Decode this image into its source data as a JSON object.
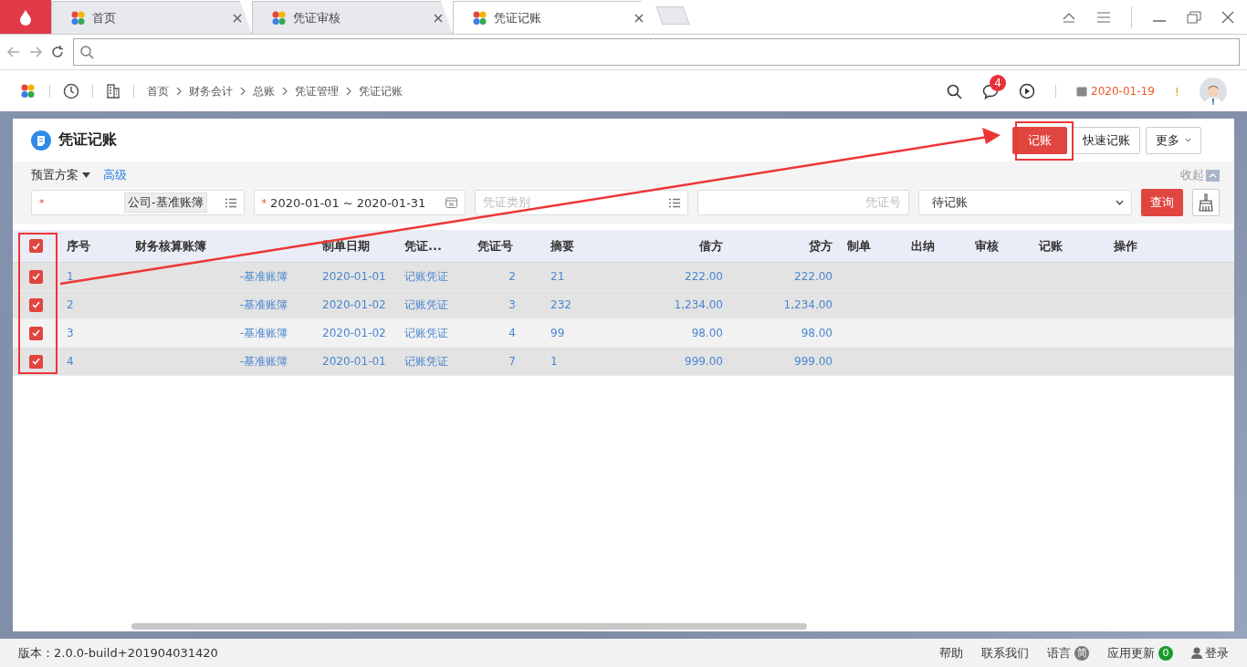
{
  "browser": {
    "tabs": [
      {
        "label": "首页",
        "selected": false
      },
      {
        "label": "凭证审核",
        "selected": false
      },
      {
        "label": "凭证记账",
        "selected": true
      }
    ]
  },
  "app_header": {
    "breadcrumb": [
      "首页",
      "财务会计",
      "总账",
      "凭证管理",
      "凭证记账"
    ],
    "notification_count": "4",
    "date": "2020-01-19",
    "alert": "!"
  },
  "page": {
    "title": "凭证记账",
    "buttons": [
      {
        "label": "记账",
        "kind": "primary"
      },
      {
        "label": "快速记账",
        "kind": "default"
      },
      {
        "label": "更多",
        "kind": "dropdown"
      }
    ]
  },
  "filters": {
    "preset": "预置方案",
    "advanced": "高级",
    "collapse": "收起",
    "ledger": {
      "value": "公司-基准账簿",
      "required_mark": "*"
    },
    "date_range": {
      "value": "2020-01-01 ~ 2020-01-31",
      "required_mark": "*"
    },
    "voucher_type": {
      "placeholder": "凭证类别"
    },
    "voucher_no": {
      "placeholder": "凭证号"
    },
    "status": {
      "value": "待记账"
    },
    "query": "查询"
  },
  "table": {
    "all_checked": true,
    "columns": [
      {
        "label": "序号",
        "kind": "text"
      },
      {
        "label": "财务核算账簿",
        "kind": "text"
      },
      {
        "label": "制单日期",
        "kind": "text"
      },
      {
        "label": "凭证...",
        "kind": "text"
      },
      {
        "label": "凭证号",
        "kind": "text"
      },
      {
        "label": "摘要",
        "kind": "text"
      },
      {
        "label": "借方",
        "kind": "amount"
      },
      {
        "label": "贷方",
        "kind": "amount"
      },
      {
        "label": "制单",
        "kind": "text"
      },
      {
        "label": "出纳",
        "kind": "text"
      },
      {
        "label": "审核",
        "kind": "text"
      },
      {
        "label": "记账",
        "kind": "text"
      },
      {
        "label": "操作",
        "kind": "action"
      }
    ],
    "rows": [
      {
        "checked": true,
        "hovered": false,
        "cells": [
          "1",
          "-基准账簿",
          "2020-01-01",
          "记账凭证",
          "2",
          "21",
          "222.00",
          "222.00"
        ]
      },
      {
        "checked": true,
        "hovered": false,
        "cells": [
          "2",
          "-基准账簿",
          "2020-01-02",
          "记账凭证",
          "3",
          "232",
          "1,234.00",
          "1,234.00"
        ]
      },
      {
        "checked": true,
        "hovered": true,
        "cells": [
          "3",
          "-基准账簿",
          "2020-01-02",
          "记账凭证",
          "4",
          "99",
          "98.00",
          "98.00"
        ]
      },
      {
        "checked": true,
        "hovered": false,
        "cells": [
          "4",
          "-基准账簿",
          "2020-01-01",
          "记账凭证",
          "7",
          "1",
          "999.00",
          "999.00"
        ]
      }
    ]
  },
  "footer": {
    "version": "版本：2.0.0-build+201904031420",
    "links": [
      "帮助",
      "联系我们"
    ],
    "language": "语言",
    "language_badge": "简",
    "update": "应用更新",
    "update_badge": "0",
    "login": "登录"
  }
}
